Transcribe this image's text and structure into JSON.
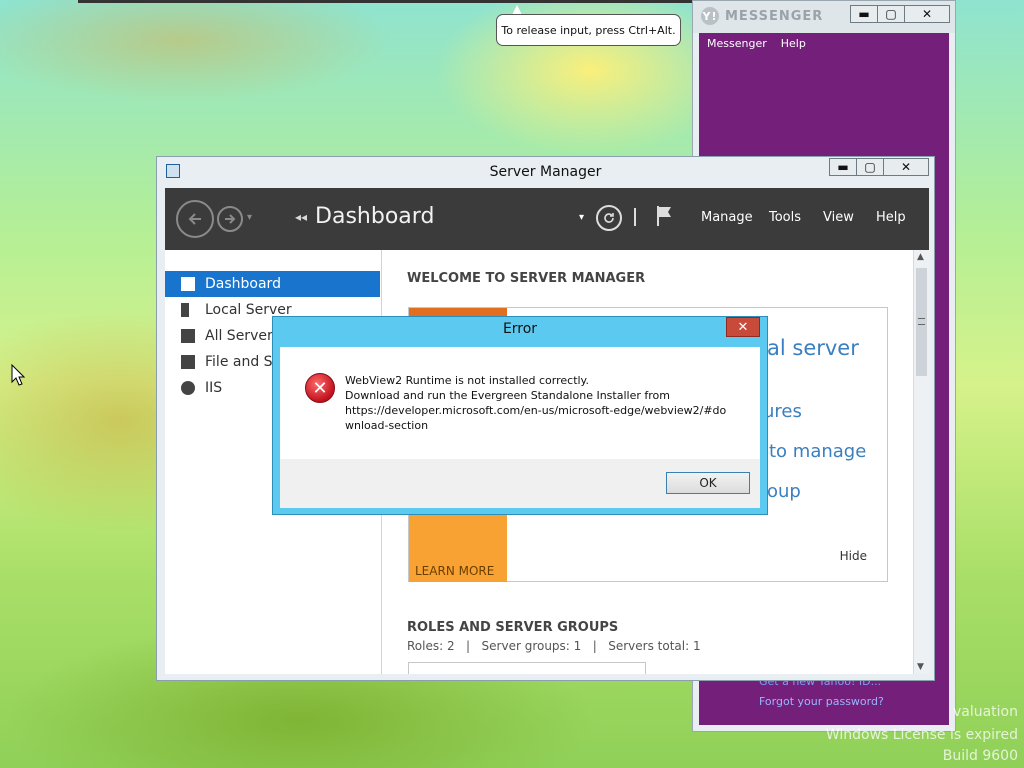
{
  "tooltip": {
    "text": "To release input, press Ctrl+Alt."
  },
  "messenger": {
    "logo_mark": "Y!",
    "brand": "MESSENGER",
    "menu": [
      "Messenger",
      "Help"
    ],
    "link_partial": "Get a new Yahoo! ID...",
    "link_forgot": "Forgot your password?",
    "window_controls": {
      "minimize": "▬",
      "maximize": "▢",
      "close": "✕"
    },
    "accent_color": "#74207a"
  },
  "watermark": {
    "line1": "valuation",
    "line2": "Windows License is expired",
    "line3": "Build 9600"
  },
  "server_manager": {
    "window_title": "Server Manager",
    "window_controls": {
      "minimize": "▬",
      "maximize": "▢",
      "close": "✕"
    },
    "breadcrumb": "Dashboard",
    "menu": [
      "Manage",
      "Tools",
      "View",
      "Help"
    ],
    "sidebar": [
      {
        "label": "Dashboard",
        "icon": "dashboard-icon",
        "active": true
      },
      {
        "label": "Local Server",
        "icon": "server-icon",
        "active": false
      },
      {
        "label": "All Servers",
        "icon": "servers-icon",
        "active": false
      },
      {
        "label": "File and Sto",
        "icon": "file-storage-icon",
        "active": false
      },
      {
        "label": "IIS",
        "icon": "iis-icon",
        "active": false
      }
    ],
    "welcome_heading": "WELCOME TO SERVER MANAGER",
    "quick_start": {
      "line1": "al server",
      "line2": "ures",
      "line3": "to manage",
      "line4": "oup",
      "learn_more": "LEARN MORE",
      "hide": "Hide"
    },
    "roles_heading": "ROLES AND SERVER GROUPS",
    "roles_summary": "Roles: 2   |   Server groups: 1   |   Servers total: 1"
  },
  "error_dialog": {
    "title": "Error",
    "close": "✕",
    "message_line1": "WebView2 Runtime is not installed correctly.",
    "message_line2": "Download and run the Evergreen Standalone Installer from",
    "message_line3": "https://developer.microsoft.com/en-us/microsoft-edge/webview2/#do",
    "message_line4": "wnload-section",
    "ok_label": "OK"
  }
}
